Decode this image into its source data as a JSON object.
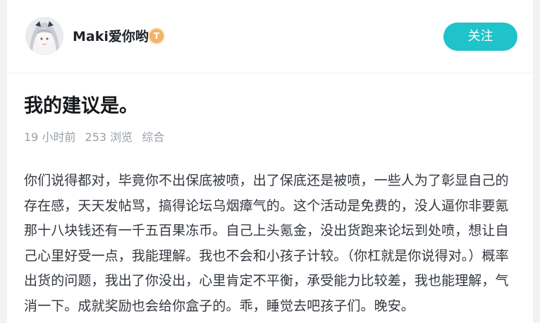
{
  "author": {
    "name": "Maki爱你哟",
    "badge": "T"
  },
  "follow_button": {
    "label": "关注"
  },
  "post": {
    "title": "我的建议是。",
    "meta": {
      "time": "19 小时前",
      "views": "253 浏览",
      "category": "综合"
    },
    "body": "你们说得都对，毕竟你不出保底被喷，出了保底还是被喷，一些人为了彰显自己的存在感，天天发帖骂，搞得论坛乌烟瘴气的。这个活动是免费的，没人逼你非要氪那十八块钱还有一千五百果冻币。自己上头氪金，没出货跑来论坛到处喷，想让自己心里好受一点，我能理解。我也不会和小孩子计较。（你杠就是你说得对。）概率出货的问题，我出了你没出，心里肯定不平衡，承受能力比较差，我也能理解，气消一下。成就奖励也会给你盒子的。乖，睡觉去吧孩子们。晚安。"
  },
  "colors": {
    "accent": "#1fc3c9",
    "badge": "#f2b36b",
    "meta_text": "#9aa0a8",
    "body_text": "#333840"
  }
}
